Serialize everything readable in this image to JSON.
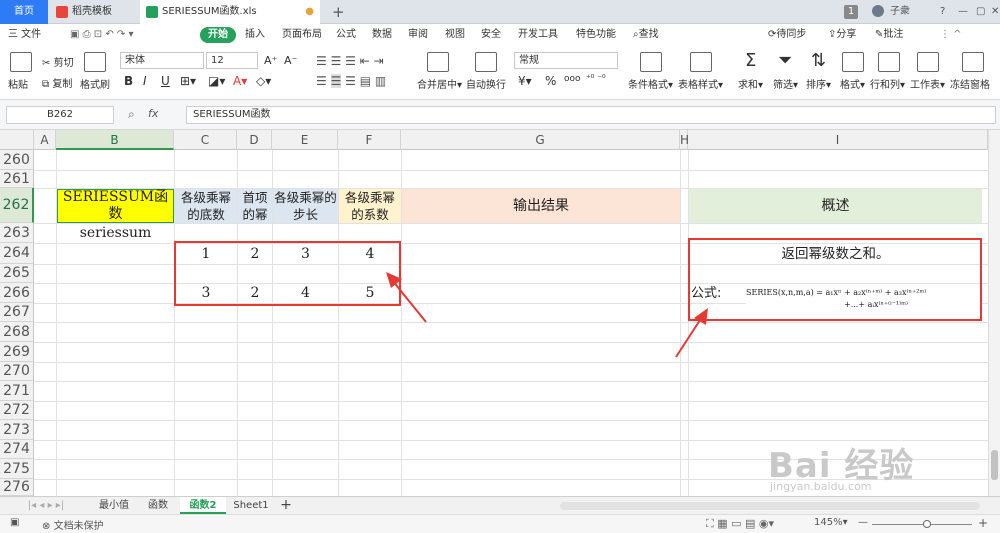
{
  "tabs": {
    "home": "首页",
    "template": "稻壳模板",
    "file": "SERIESSUM函数.xls",
    "new_tab": "+"
  },
  "titlebar": {
    "badge": "1",
    "user": "子衆",
    "help": "?"
  },
  "menu": {
    "file": "三 文件",
    "items": [
      "开始",
      "插入",
      "页面布局",
      "公式",
      "数据",
      "审阅",
      "视图",
      "安全",
      "开发工具",
      "特色功能"
    ],
    "search": "查找",
    "sync": "待同步",
    "share": "分享",
    "comment": "批注"
  },
  "ribbon": {
    "paste": "粘贴",
    "cut": "剪切",
    "copy": "复制",
    "format_painter": "格式刷",
    "font_name": "宋体",
    "font_size": "12",
    "grow": "A⁺",
    "shrink": "A⁻",
    "bold": "B",
    "italic": "I",
    "underline": "U",
    "merge": "合并居中",
    "wrap": "自动换行",
    "number_format": "常规",
    "currency": "¥",
    "percent": "%",
    "cond_format": "条件格式",
    "table_style": "表格样式",
    "sum": "求和",
    "filter": "筛选",
    "sort": "排序",
    "format": "格式",
    "rowcol": "行和列",
    "sheet": "工作表",
    "freeze": "冻结窗格"
  },
  "formula_bar": {
    "name_box": "B262",
    "fx": "fx",
    "content": "SERIESSUM函数"
  },
  "columns": [
    "A",
    "B",
    "C",
    "D",
    "E",
    "F",
    "G",
    "H",
    "I"
  ],
  "rows": [
    "260",
    "261",
    "262",
    "263",
    "264",
    "265",
    "266",
    "267",
    "268",
    "269",
    "270",
    "271",
    "272",
    "273",
    "274",
    "275",
    "276"
  ],
  "cells": {
    "b262": "SERIESSUM函数",
    "c262": "各级乘幂的底数",
    "d262": "首项的幂",
    "e262": "各级乘幂的步长",
    "f262": "各级乘幂的系数",
    "g262": "输出结果",
    "i262": "概述",
    "b263": "seriessum",
    "c264": "1",
    "d264": "2",
    "e264": "3",
    "f264": "4",
    "c266": "3",
    "d266": "2",
    "e266": "4",
    "f266": "5",
    "i264": "返回幂级数之和。",
    "i266_label": "公式:",
    "formula_line1": "SERIES(x,n,m,a) = a₁xⁿ + a₂x⁽ⁿ⁺ᵐ⁾ + a₃x⁽ⁿ⁺²ᵐ⁾",
    "formula_line2": "+...+ aᵢx⁽ⁿ⁺⁽ⁱ⁻¹⁾ᵐ⁾"
  },
  "sheets": [
    "最小值",
    "函数",
    "函数2",
    "Sheet1"
  ],
  "active_sheet": "函数2",
  "status": {
    "protect": "文档未保护",
    "zoom": "145%"
  },
  "watermark": {
    "brand": "Bai 经验",
    "url": "jingyan.baidu.com"
  },
  "colors": {
    "accent_green": "#25a15b",
    "header_yellow": "#ffff00",
    "header_blue": "#dce6f1",
    "header_peach": "#fce4d6",
    "header_green": "#e2efda",
    "header_cream": "#fff2cc",
    "annotation_red": "#e53935"
  }
}
